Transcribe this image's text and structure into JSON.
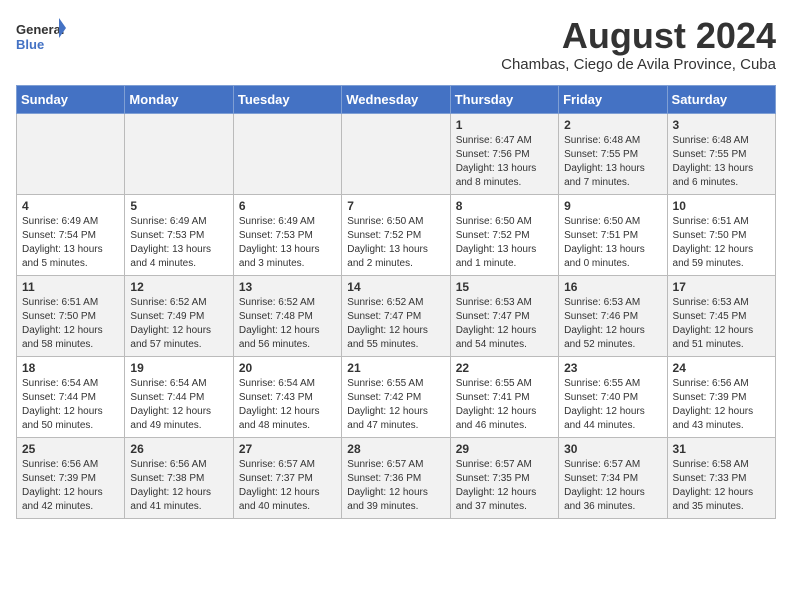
{
  "header": {
    "logo_general": "General",
    "logo_blue": "Blue",
    "month_title": "August 2024",
    "subtitle": "Chambas, Ciego de Avila Province, Cuba"
  },
  "days_of_week": [
    "Sunday",
    "Monday",
    "Tuesday",
    "Wednesday",
    "Thursday",
    "Friday",
    "Saturday"
  ],
  "weeks": [
    [
      {
        "day": "",
        "content": ""
      },
      {
        "day": "",
        "content": ""
      },
      {
        "day": "",
        "content": ""
      },
      {
        "day": "",
        "content": ""
      },
      {
        "day": "1",
        "content": "Sunrise: 6:47 AM\nSunset: 7:56 PM\nDaylight: 13 hours\nand 8 minutes."
      },
      {
        "day": "2",
        "content": "Sunrise: 6:48 AM\nSunset: 7:55 PM\nDaylight: 13 hours\nand 7 minutes."
      },
      {
        "day": "3",
        "content": "Sunrise: 6:48 AM\nSunset: 7:55 PM\nDaylight: 13 hours\nand 6 minutes."
      }
    ],
    [
      {
        "day": "4",
        "content": "Sunrise: 6:49 AM\nSunset: 7:54 PM\nDaylight: 13 hours\nand 5 minutes."
      },
      {
        "day": "5",
        "content": "Sunrise: 6:49 AM\nSunset: 7:53 PM\nDaylight: 13 hours\nand 4 minutes."
      },
      {
        "day": "6",
        "content": "Sunrise: 6:49 AM\nSunset: 7:53 PM\nDaylight: 13 hours\nand 3 minutes."
      },
      {
        "day": "7",
        "content": "Sunrise: 6:50 AM\nSunset: 7:52 PM\nDaylight: 13 hours\nand 2 minutes."
      },
      {
        "day": "8",
        "content": "Sunrise: 6:50 AM\nSunset: 7:52 PM\nDaylight: 13 hours\nand 1 minute."
      },
      {
        "day": "9",
        "content": "Sunrise: 6:50 AM\nSunset: 7:51 PM\nDaylight: 13 hours\nand 0 minutes."
      },
      {
        "day": "10",
        "content": "Sunrise: 6:51 AM\nSunset: 7:50 PM\nDaylight: 12 hours\nand 59 minutes."
      }
    ],
    [
      {
        "day": "11",
        "content": "Sunrise: 6:51 AM\nSunset: 7:50 PM\nDaylight: 12 hours\nand 58 minutes."
      },
      {
        "day": "12",
        "content": "Sunrise: 6:52 AM\nSunset: 7:49 PM\nDaylight: 12 hours\nand 57 minutes."
      },
      {
        "day": "13",
        "content": "Sunrise: 6:52 AM\nSunset: 7:48 PM\nDaylight: 12 hours\nand 56 minutes."
      },
      {
        "day": "14",
        "content": "Sunrise: 6:52 AM\nSunset: 7:47 PM\nDaylight: 12 hours\nand 55 minutes."
      },
      {
        "day": "15",
        "content": "Sunrise: 6:53 AM\nSunset: 7:47 PM\nDaylight: 12 hours\nand 54 minutes."
      },
      {
        "day": "16",
        "content": "Sunrise: 6:53 AM\nSunset: 7:46 PM\nDaylight: 12 hours\nand 52 minutes."
      },
      {
        "day": "17",
        "content": "Sunrise: 6:53 AM\nSunset: 7:45 PM\nDaylight: 12 hours\nand 51 minutes."
      }
    ],
    [
      {
        "day": "18",
        "content": "Sunrise: 6:54 AM\nSunset: 7:44 PM\nDaylight: 12 hours\nand 50 minutes."
      },
      {
        "day": "19",
        "content": "Sunrise: 6:54 AM\nSunset: 7:44 PM\nDaylight: 12 hours\nand 49 minutes."
      },
      {
        "day": "20",
        "content": "Sunrise: 6:54 AM\nSunset: 7:43 PM\nDaylight: 12 hours\nand 48 minutes."
      },
      {
        "day": "21",
        "content": "Sunrise: 6:55 AM\nSunset: 7:42 PM\nDaylight: 12 hours\nand 47 minutes."
      },
      {
        "day": "22",
        "content": "Sunrise: 6:55 AM\nSunset: 7:41 PM\nDaylight: 12 hours\nand 46 minutes."
      },
      {
        "day": "23",
        "content": "Sunrise: 6:55 AM\nSunset: 7:40 PM\nDaylight: 12 hours\nand 44 minutes."
      },
      {
        "day": "24",
        "content": "Sunrise: 6:56 AM\nSunset: 7:39 PM\nDaylight: 12 hours\nand 43 minutes."
      }
    ],
    [
      {
        "day": "25",
        "content": "Sunrise: 6:56 AM\nSunset: 7:39 PM\nDaylight: 12 hours\nand 42 minutes."
      },
      {
        "day": "26",
        "content": "Sunrise: 6:56 AM\nSunset: 7:38 PM\nDaylight: 12 hours\nand 41 minutes."
      },
      {
        "day": "27",
        "content": "Sunrise: 6:57 AM\nSunset: 7:37 PM\nDaylight: 12 hours\nand 40 minutes."
      },
      {
        "day": "28",
        "content": "Sunrise: 6:57 AM\nSunset: 7:36 PM\nDaylight: 12 hours\nand 39 minutes."
      },
      {
        "day": "29",
        "content": "Sunrise: 6:57 AM\nSunset: 7:35 PM\nDaylight: 12 hours\nand 37 minutes."
      },
      {
        "day": "30",
        "content": "Sunrise: 6:57 AM\nSunset: 7:34 PM\nDaylight: 12 hours\nand 36 minutes."
      },
      {
        "day": "31",
        "content": "Sunrise: 6:58 AM\nSunset: 7:33 PM\nDaylight: 12 hours\nand 35 minutes."
      }
    ]
  ]
}
